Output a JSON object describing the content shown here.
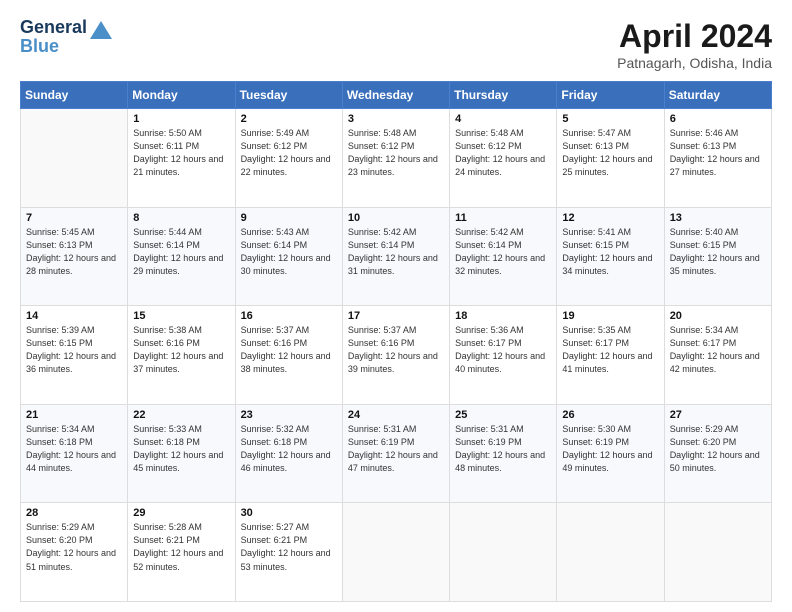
{
  "logo": {
    "line1": "General",
    "line2": "Blue"
  },
  "title": "April 2024",
  "location": "Patnagarh, Odisha, India",
  "weekdays": [
    "Sunday",
    "Monday",
    "Tuesday",
    "Wednesday",
    "Thursday",
    "Friday",
    "Saturday"
  ],
  "weeks": [
    [
      {
        "day": "",
        "sunrise": "",
        "sunset": "",
        "daylight": ""
      },
      {
        "day": "1",
        "sunrise": "Sunrise: 5:50 AM",
        "sunset": "Sunset: 6:11 PM",
        "daylight": "Daylight: 12 hours and 21 minutes."
      },
      {
        "day": "2",
        "sunrise": "Sunrise: 5:49 AM",
        "sunset": "Sunset: 6:12 PM",
        "daylight": "Daylight: 12 hours and 22 minutes."
      },
      {
        "day": "3",
        "sunrise": "Sunrise: 5:48 AM",
        "sunset": "Sunset: 6:12 PM",
        "daylight": "Daylight: 12 hours and 23 minutes."
      },
      {
        "day": "4",
        "sunrise": "Sunrise: 5:48 AM",
        "sunset": "Sunset: 6:12 PM",
        "daylight": "Daylight: 12 hours and 24 minutes."
      },
      {
        "day": "5",
        "sunrise": "Sunrise: 5:47 AM",
        "sunset": "Sunset: 6:13 PM",
        "daylight": "Daylight: 12 hours and 25 minutes."
      },
      {
        "day": "6",
        "sunrise": "Sunrise: 5:46 AM",
        "sunset": "Sunset: 6:13 PM",
        "daylight": "Daylight: 12 hours and 27 minutes."
      }
    ],
    [
      {
        "day": "7",
        "sunrise": "Sunrise: 5:45 AM",
        "sunset": "Sunset: 6:13 PM",
        "daylight": "Daylight: 12 hours and 28 minutes."
      },
      {
        "day": "8",
        "sunrise": "Sunrise: 5:44 AM",
        "sunset": "Sunset: 6:14 PM",
        "daylight": "Daylight: 12 hours and 29 minutes."
      },
      {
        "day": "9",
        "sunrise": "Sunrise: 5:43 AM",
        "sunset": "Sunset: 6:14 PM",
        "daylight": "Daylight: 12 hours and 30 minutes."
      },
      {
        "day": "10",
        "sunrise": "Sunrise: 5:42 AM",
        "sunset": "Sunset: 6:14 PM",
        "daylight": "Daylight: 12 hours and 31 minutes."
      },
      {
        "day": "11",
        "sunrise": "Sunrise: 5:42 AM",
        "sunset": "Sunset: 6:14 PM",
        "daylight": "Daylight: 12 hours and 32 minutes."
      },
      {
        "day": "12",
        "sunrise": "Sunrise: 5:41 AM",
        "sunset": "Sunset: 6:15 PM",
        "daylight": "Daylight: 12 hours and 34 minutes."
      },
      {
        "day": "13",
        "sunrise": "Sunrise: 5:40 AM",
        "sunset": "Sunset: 6:15 PM",
        "daylight": "Daylight: 12 hours and 35 minutes."
      }
    ],
    [
      {
        "day": "14",
        "sunrise": "Sunrise: 5:39 AM",
        "sunset": "Sunset: 6:15 PM",
        "daylight": "Daylight: 12 hours and 36 minutes."
      },
      {
        "day": "15",
        "sunrise": "Sunrise: 5:38 AM",
        "sunset": "Sunset: 6:16 PM",
        "daylight": "Daylight: 12 hours and 37 minutes."
      },
      {
        "day": "16",
        "sunrise": "Sunrise: 5:37 AM",
        "sunset": "Sunset: 6:16 PM",
        "daylight": "Daylight: 12 hours and 38 minutes."
      },
      {
        "day": "17",
        "sunrise": "Sunrise: 5:37 AM",
        "sunset": "Sunset: 6:16 PM",
        "daylight": "Daylight: 12 hours and 39 minutes."
      },
      {
        "day": "18",
        "sunrise": "Sunrise: 5:36 AM",
        "sunset": "Sunset: 6:17 PM",
        "daylight": "Daylight: 12 hours and 40 minutes."
      },
      {
        "day": "19",
        "sunrise": "Sunrise: 5:35 AM",
        "sunset": "Sunset: 6:17 PM",
        "daylight": "Daylight: 12 hours and 41 minutes."
      },
      {
        "day": "20",
        "sunrise": "Sunrise: 5:34 AM",
        "sunset": "Sunset: 6:17 PM",
        "daylight": "Daylight: 12 hours and 42 minutes."
      }
    ],
    [
      {
        "day": "21",
        "sunrise": "Sunrise: 5:34 AM",
        "sunset": "Sunset: 6:18 PM",
        "daylight": "Daylight: 12 hours and 44 minutes."
      },
      {
        "day": "22",
        "sunrise": "Sunrise: 5:33 AM",
        "sunset": "Sunset: 6:18 PM",
        "daylight": "Daylight: 12 hours and 45 minutes."
      },
      {
        "day": "23",
        "sunrise": "Sunrise: 5:32 AM",
        "sunset": "Sunset: 6:18 PM",
        "daylight": "Daylight: 12 hours and 46 minutes."
      },
      {
        "day": "24",
        "sunrise": "Sunrise: 5:31 AM",
        "sunset": "Sunset: 6:19 PM",
        "daylight": "Daylight: 12 hours and 47 minutes."
      },
      {
        "day": "25",
        "sunrise": "Sunrise: 5:31 AM",
        "sunset": "Sunset: 6:19 PM",
        "daylight": "Daylight: 12 hours and 48 minutes."
      },
      {
        "day": "26",
        "sunrise": "Sunrise: 5:30 AM",
        "sunset": "Sunset: 6:19 PM",
        "daylight": "Daylight: 12 hours and 49 minutes."
      },
      {
        "day": "27",
        "sunrise": "Sunrise: 5:29 AM",
        "sunset": "Sunset: 6:20 PM",
        "daylight": "Daylight: 12 hours and 50 minutes."
      }
    ],
    [
      {
        "day": "28",
        "sunrise": "Sunrise: 5:29 AM",
        "sunset": "Sunset: 6:20 PM",
        "daylight": "Daylight: 12 hours and 51 minutes."
      },
      {
        "day": "29",
        "sunrise": "Sunrise: 5:28 AM",
        "sunset": "Sunset: 6:21 PM",
        "daylight": "Daylight: 12 hours and 52 minutes."
      },
      {
        "day": "30",
        "sunrise": "Sunrise: 5:27 AM",
        "sunset": "Sunset: 6:21 PM",
        "daylight": "Daylight: 12 hours and 53 minutes."
      },
      {
        "day": "",
        "sunrise": "",
        "sunset": "",
        "daylight": ""
      },
      {
        "day": "",
        "sunrise": "",
        "sunset": "",
        "daylight": ""
      },
      {
        "day": "",
        "sunrise": "",
        "sunset": "",
        "daylight": ""
      },
      {
        "day": "",
        "sunrise": "",
        "sunset": "",
        "daylight": ""
      }
    ]
  ]
}
